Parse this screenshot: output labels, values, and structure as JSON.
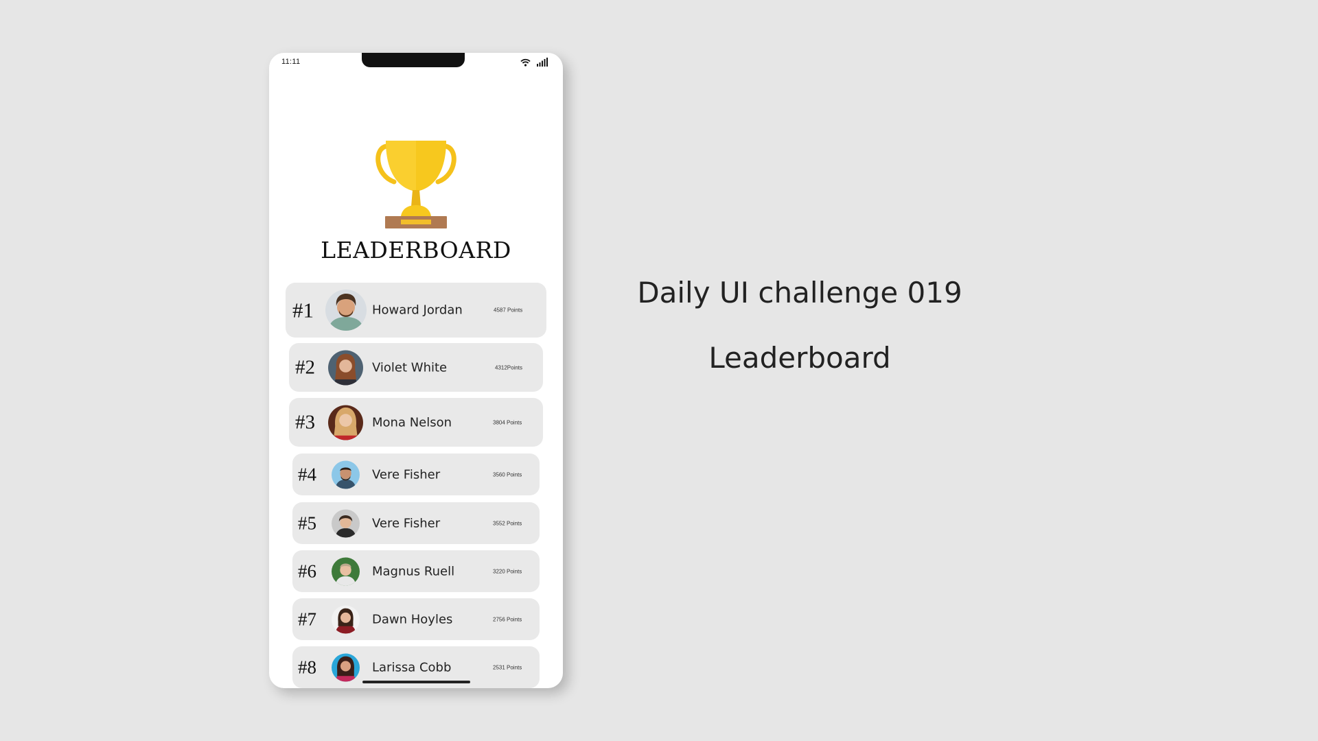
{
  "status_bar": {
    "time": "11:11",
    "icons": [
      "wifi-icon",
      "signal-icon"
    ]
  },
  "header": {
    "icon": "trophy-icon",
    "title": "LEADERBOARD"
  },
  "leaderboard": [
    {
      "rank": "#1",
      "name": "Howard Jordan",
      "points": "4587 Points"
    },
    {
      "rank": "#2",
      "name": "Violet White",
      "points": "4312Points"
    },
    {
      "rank": "#3",
      "name": "Mona Nelson",
      "points": "3804 Points"
    },
    {
      "rank": "#4",
      "name": "Vere Fisher",
      "points": "3560 Points"
    },
    {
      "rank": "#5",
      "name": "Vere Fisher",
      "points": "3552 Points"
    },
    {
      "rank": "#6",
      "name": "Magnus Ruell",
      "points": "3220 Points"
    },
    {
      "rank": "#7",
      "name": "Dawn Hoyles",
      "points": "2756 Points"
    },
    {
      "rank": "#8",
      "name": "Larissa Cobb",
      "points": "2531 Points"
    }
  ],
  "caption": {
    "title": "Daily UI challenge 019",
    "subtitle": "Leaderboard"
  },
  "colors": {
    "background": "#e6e6e6",
    "phone": "#ffffff",
    "row": "#e9e9e9",
    "trophy_gold": "#f7c81e",
    "trophy_base": "#b07a52"
  }
}
